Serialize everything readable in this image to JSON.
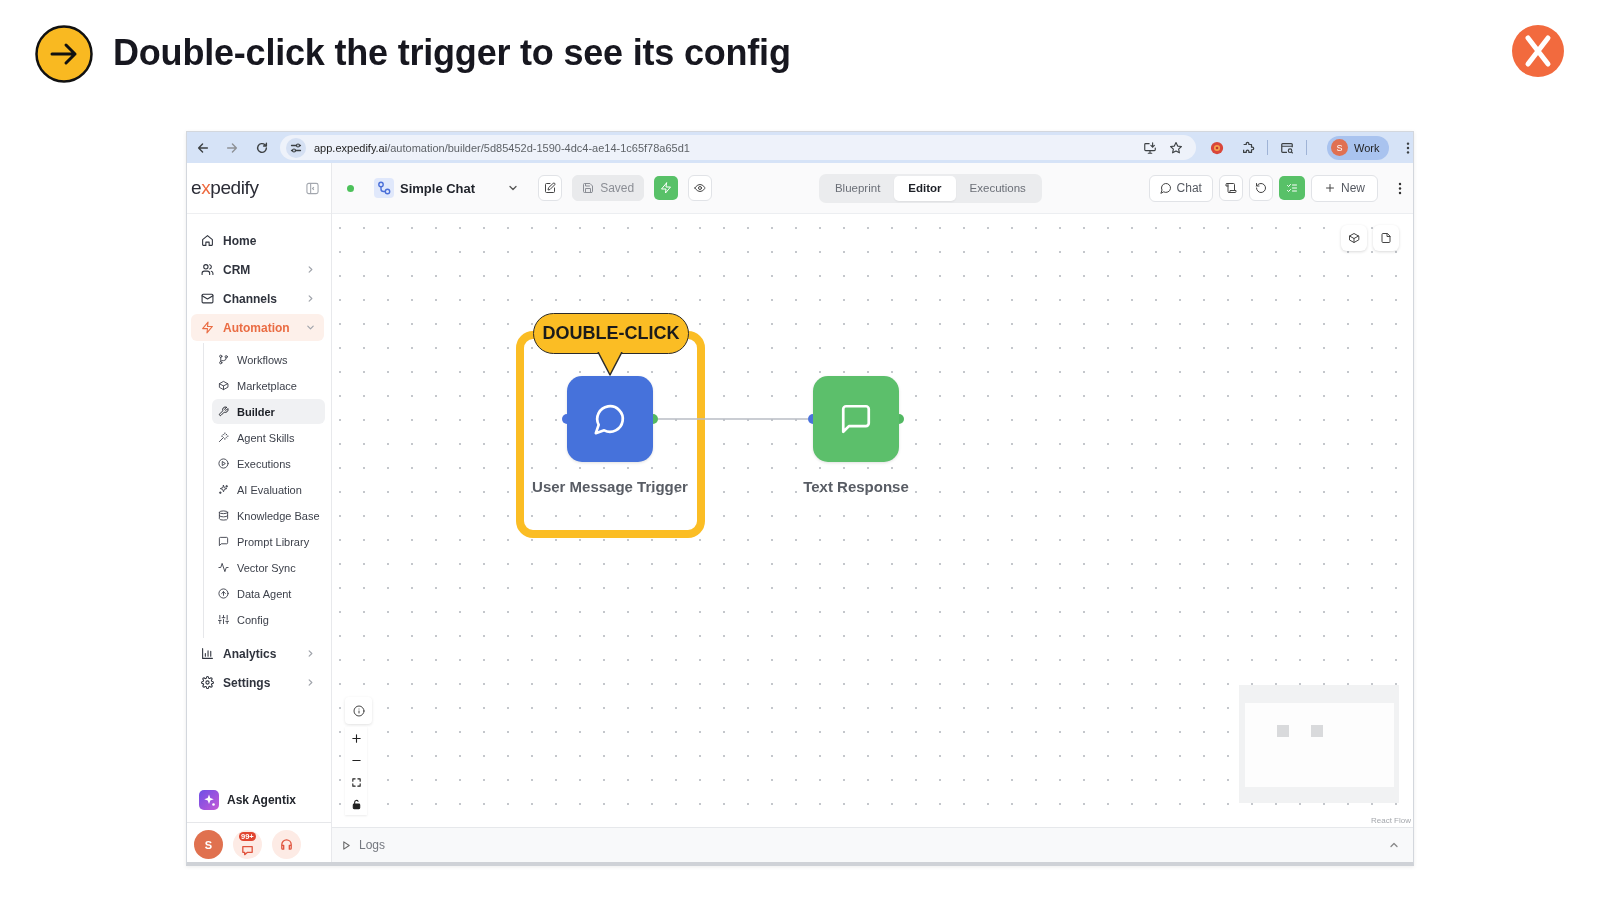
{
  "header": {
    "title": "Double-click the trigger to see its config"
  },
  "browser": {
    "url": {
      "host": "app.expedify.ai",
      "path": "/automation/builder/5d85452d-1590-4dc4-ae14-1c65f78a65d1"
    },
    "profile": {
      "initial": "S",
      "label": "Work"
    }
  },
  "sidebar": {
    "logo": [
      {
        "text": "e",
        "accent": false
      },
      {
        "text": "x",
        "accent": true
      },
      {
        "text": "pedify",
        "accent": false
      }
    ],
    "items": [
      {
        "label": "Home",
        "kind": "link",
        "selected": false
      },
      {
        "label": "CRM",
        "kind": "group",
        "expanded": false,
        "selected": false
      },
      {
        "label": "Channels",
        "kind": "group",
        "expanded": false,
        "selected": false
      },
      {
        "label": "Automation",
        "kind": "group",
        "expanded": true,
        "selected": true,
        "children": [
          {
            "label": "Workflows",
            "selected": false
          },
          {
            "label": "Marketplace",
            "selected": false
          },
          {
            "label": "Builder",
            "selected": true
          },
          {
            "label": "Agent Skills",
            "selected": false
          },
          {
            "label": "Executions",
            "selected": false
          },
          {
            "label": "AI Evaluation",
            "selected": false
          },
          {
            "label": "Knowledge Base",
            "selected": false
          },
          {
            "label": "Prompt Library",
            "selected": false
          },
          {
            "label": "Vector Sync",
            "selected": false
          },
          {
            "label": "Data Agent",
            "selected": false
          },
          {
            "label": "Config",
            "selected": false
          }
        ]
      },
      {
        "label": "Analytics",
        "kind": "group",
        "expanded": false,
        "selected": false
      },
      {
        "label": "Settings",
        "kind": "group",
        "expanded": false,
        "selected": false
      }
    ],
    "assistant": {
      "label": "Ask Agentix"
    },
    "footer": {
      "avatar": "S",
      "badge": "99+"
    }
  },
  "toolbar": {
    "workflow_name": "Simple Chat",
    "saved": {
      "label": "Saved",
      "disabled": true
    },
    "tabs": [
      {
        "label": "Blueprint",
        "selected": false
      },
      {
        "label": "Editor",
        "selected": true
      },
      {
        "label": "Executions",
        "selected": false
      }
    ],
    "chat": {
      "label": "Chat"
    },
    "new": {
      "label": "New"
    }
  },
  "canvas": {
    "nodes": [
      {
        "label": "User Message Trigger",
        "color": "#4672db",
        "highlighted": true,
        "callout": "DOUBLE-CLICK"
      },
      {
        "label": "Text Response",
        "color": "#5cbf6b",
        "highlighted": false
      }
    ],
    "attribution": "React Flow"
  },
  "logs": {
    "label": "Logs",
    "expanded": false
  }
}
